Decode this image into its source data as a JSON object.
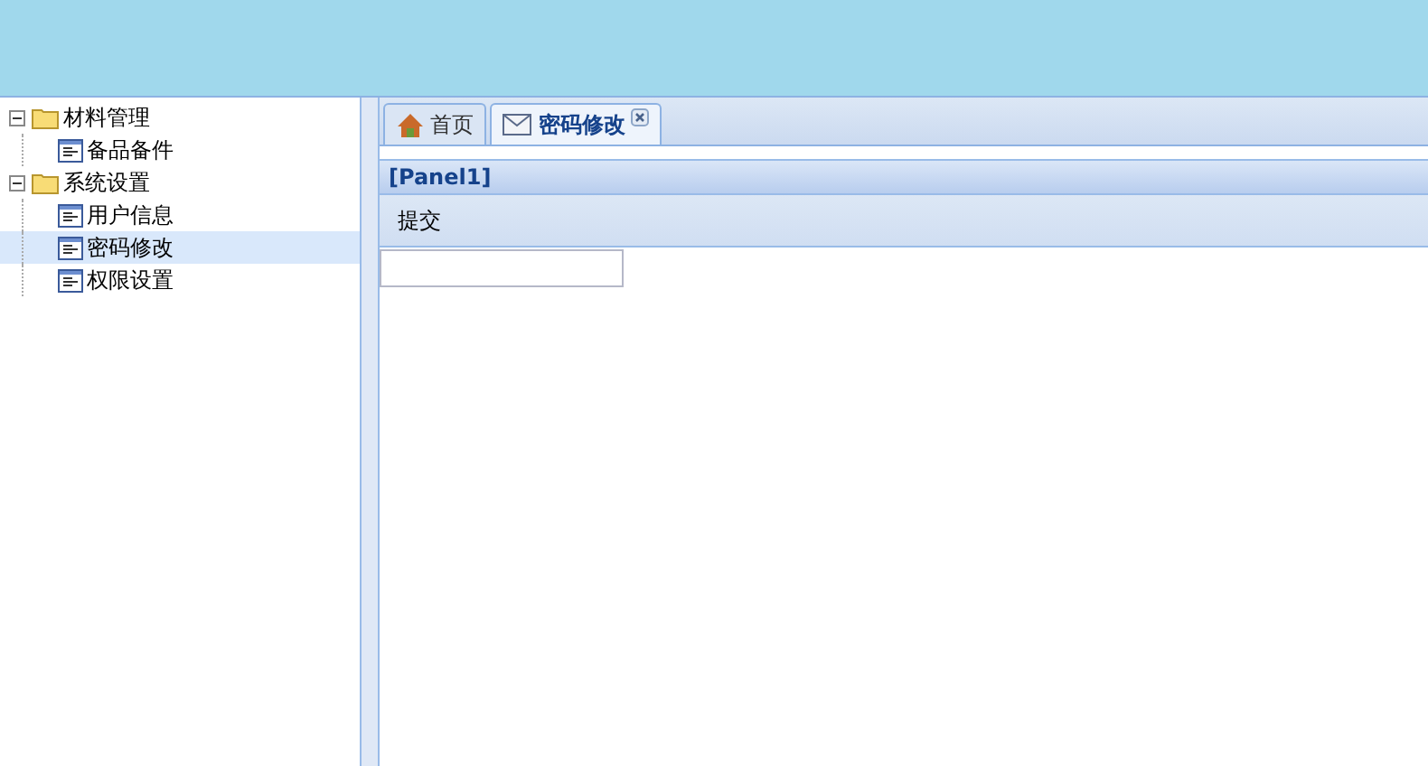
{
  "tree": [
    {
      "label": "材料管理",
      "expanded": true,
      "children": [
        {
          "label": "备品备件",
          "selected": false
        }
      ]
    },
    {
      "label": "系统设置",
      "expanded": true,
      "children": [
        {
          "label": "用户信息",
          "selected": false
        },
        {
          "label": "密码修改",
          "selected": true
        },
        {
          "label": "权限设置",
          "selected": false
        }
      ]
    }
  ],
  "tabs": [
    {
      "label": "首页",
      "kind": "home",
      "selected": false,
      "closable": false
    },
    {
      "label": "密码修改",
      "kind": "mail",
      "selected": true,
      "closable": true
    }
  ],
  "panel": {
    "title": "[Panel1]",
    "toolbar": [
      "提交"
    ]
  }
}
